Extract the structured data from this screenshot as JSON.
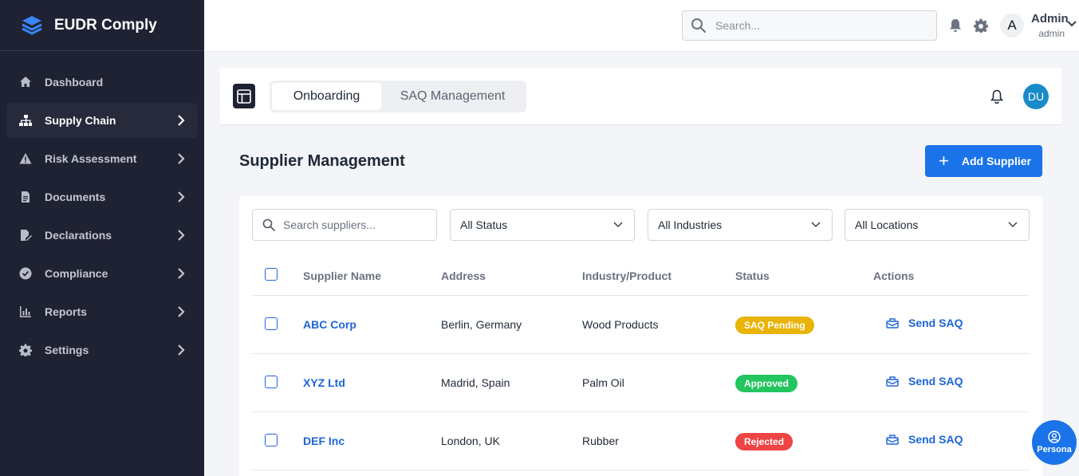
{
  "app": {
    "name": "EUDR Comply"
  },
  "sidebar": {
    "items": [
      {
        "label": "Dashboard",
        "icon": "home-icon",
        "has_arrow": false,
        "active": false
      },
      {
        "label": "Supply Chain",
        "icon": "sitemap-icon",
        "has_arrow": true,
        "active": true
      },
      {
        "label": "Risk Assessment",
        "icon": "warning-icon",
        "has_arrow": true,
        "active": false
      },
      {
        "label": "Documents",
        "icon": "document-icon",
        "has_arrow": true,
        "active": false
      },
      {
        "label": "Declarations",
        "icon": "signature-icon",
        "has_arrow": true,
        "active": false
      },
      {
        "label": "Compliance",
        "icon": "check-circle-icon",
        "has_arrow": true,
        "active": false
      },
      {
        "label": "Reports",
        "icon": "bar-chart-icon",
        "has_arrow": true,
        "active": false
      },
      {
        "label": "Settings",
        "icon": "gear-icon",
        "has_arrow": true,
        "active": false
      }
    ]
  },
  "topbar": {
    "search_placeholder": "Search...",
    "avatar_letter": "A",
    "user_name": "Admin",
    "user_role": "admin"
  },
  "header": {
    "tabs": [
      {
        "label": "Onboarding",
        "active": true
      },
      {
        "label": "SAQ Management",
        "active": false
      }
    ],
    "avatar_initials": "DU"
  },
  "page": {
    "title": "Supplier Management",
    "add_button_label": "Add Supplier"
  },
  "filters": {
    "search_placeholder": "Search suppliers...",
    "status": "All Status",
    "industries": "All Industries",
    "locations": "All Locations"
  },
  "table": {
    "columns": [
      "Supplier Name",
      "Address",
      "Industry/Product",
      "Status",
      "Actions"
    ],
    "rows": [
      {
        "name": "ABC Corp",
        "address": "Berlin, Germany",
        "industry": "Wood Products",
        "status": "SAQ Pending",
        "status_color": "#eab308",
        "action": "Send SAQ"
      },
      {
        "name": "XYZ Ltd",
        "address": "Madrid, Spain",
        "industry": "Palm Oil",
        "status": "Approved",
        "status_color": "#22c55e",
        "action": "Send SAQ"
      },
      {
        "name": "DEF Inc",
        "address": "London, UK",
        "industry": "Rubber",
        "status": "Rejected",
        "status_color": "#ef4444",
        "action": "Send SAQ"
      }
    ]
  },
  "persona": {
    "label": "Persona"
  },
  "colors": {
    "sidebar_bg": "#1f2233",
    "primary": "#1a73e8",
    "link": "#1d64d8"
  }
}
